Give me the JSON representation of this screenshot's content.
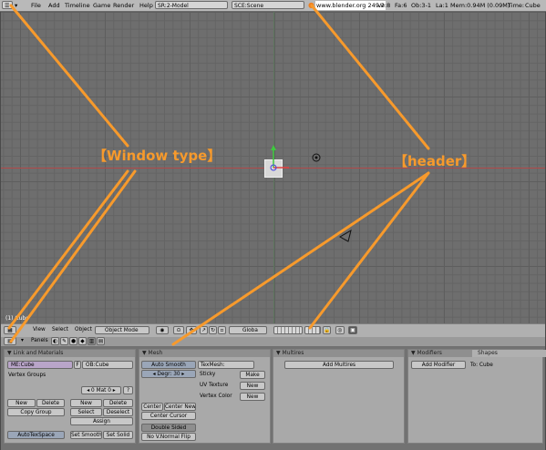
{
  "topbar": {
    "menus": [
      "File",
      "Add",
      "Timeline",
      "Game",
      "Render",
      "Help"
    ],
    "screen_field": "SR:2-Model",
    "scene_field": "SCE:Scene",
    "stats": {
      "url": "www.blender.org 249.2",
      "ve": "Ve:8",
      "fa": "Fa:6",
      "ob": "Ob:3-1",
      "la": "La:1",
      "mem": "Mem:0.94M (0.09M)",
      "time": "Time:",
      "name": "Cube"
    }
  },
  "viewport": {
    "object_label": "(1) Cube",
    "background": "#6e6e6e"
  },
  "viewport_header": {
    "view": "View",
    "select": "Select",
    "object": "Object",
    "mode": "Object Mode",
    "pivot": "Globa"
  },
  "buttons_header": {
    "panels": "Panels"
  },
  "link_materials": {
    "title": "Link and Materials",
    "me_field": "ME:Cube",
    "f_label": "F",
    "ob_field": "OB:Cube",
    "vertex_groups": "Vertex Groups",
    "mat_field": "0 Mat 0",
    "q_button": "?",
    "buttons": {
      "new1": "New",
      "delete1": "Delete",
      "copy_group": "Copy Group",
      "new2": "New",
      "delete2": "Delete",
      "select": "Select",
      "deselect": "Deselect",
      "assign": "Assign",
      "autotexspace": "AutoTexSpace",
      "set_smooth": "Set Smooth",
      "set_solid": "Set Solid"
    }
  },
  "mesh": {
    "title": "Mesh",
    "auto_smooth": "Auto Smooth",
    "degr": "Degr: 30",
    "texmesh": "TexMesh:",
    "sticky": "Sticky",
    "make": "Make",
    "uv_texture": "UV Texture",
    "new1": "New",
    "vertex_color": "Vertex Color",
    "new2": "New",
    "center": "Center",
    "center_new": "Center New",
    "center_cursor": "Center Cursor",
    "double_sided": "Double Sided",
    "no_vnormal_flip": "No V.Normal Flip"
  },
  "multires": {
    "title": "Multires",
    "add_multires": "Add Multires"
  },
  "modifiers": {
    "tab_modifiers": "Modifiers",
    "tab_shapes": "Shapes",
    "add_modifier": "Add Modifier",
    "to": "To: Cube"
  },
  "annotations": {
    "window_type": "【Window type】",
    "header": "【header】",
    "color": "#f79a2c"
  }
}
